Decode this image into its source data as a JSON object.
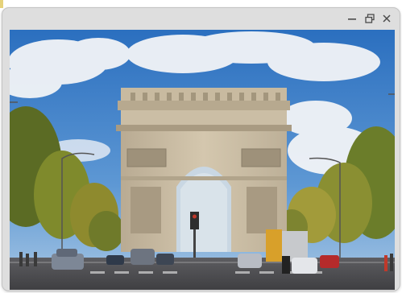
{
  "window": {
    "title": "",
    "controls": {
      "minimize_icon": "minimize-icon",
      "restore_icon": "restore-icon",
      "close_icon": "close-icon"
    }
  },
  "image": {
    "alt": "Arc de Triomphe"
  },
  "colors": {
    "window_frame": "#dedede",
    "sky": "#2f78c4",
    "stone": "#cdbfa6",
    "road": "#4f4f52",
    "foliage": "#6b7d2a"
  }
}
